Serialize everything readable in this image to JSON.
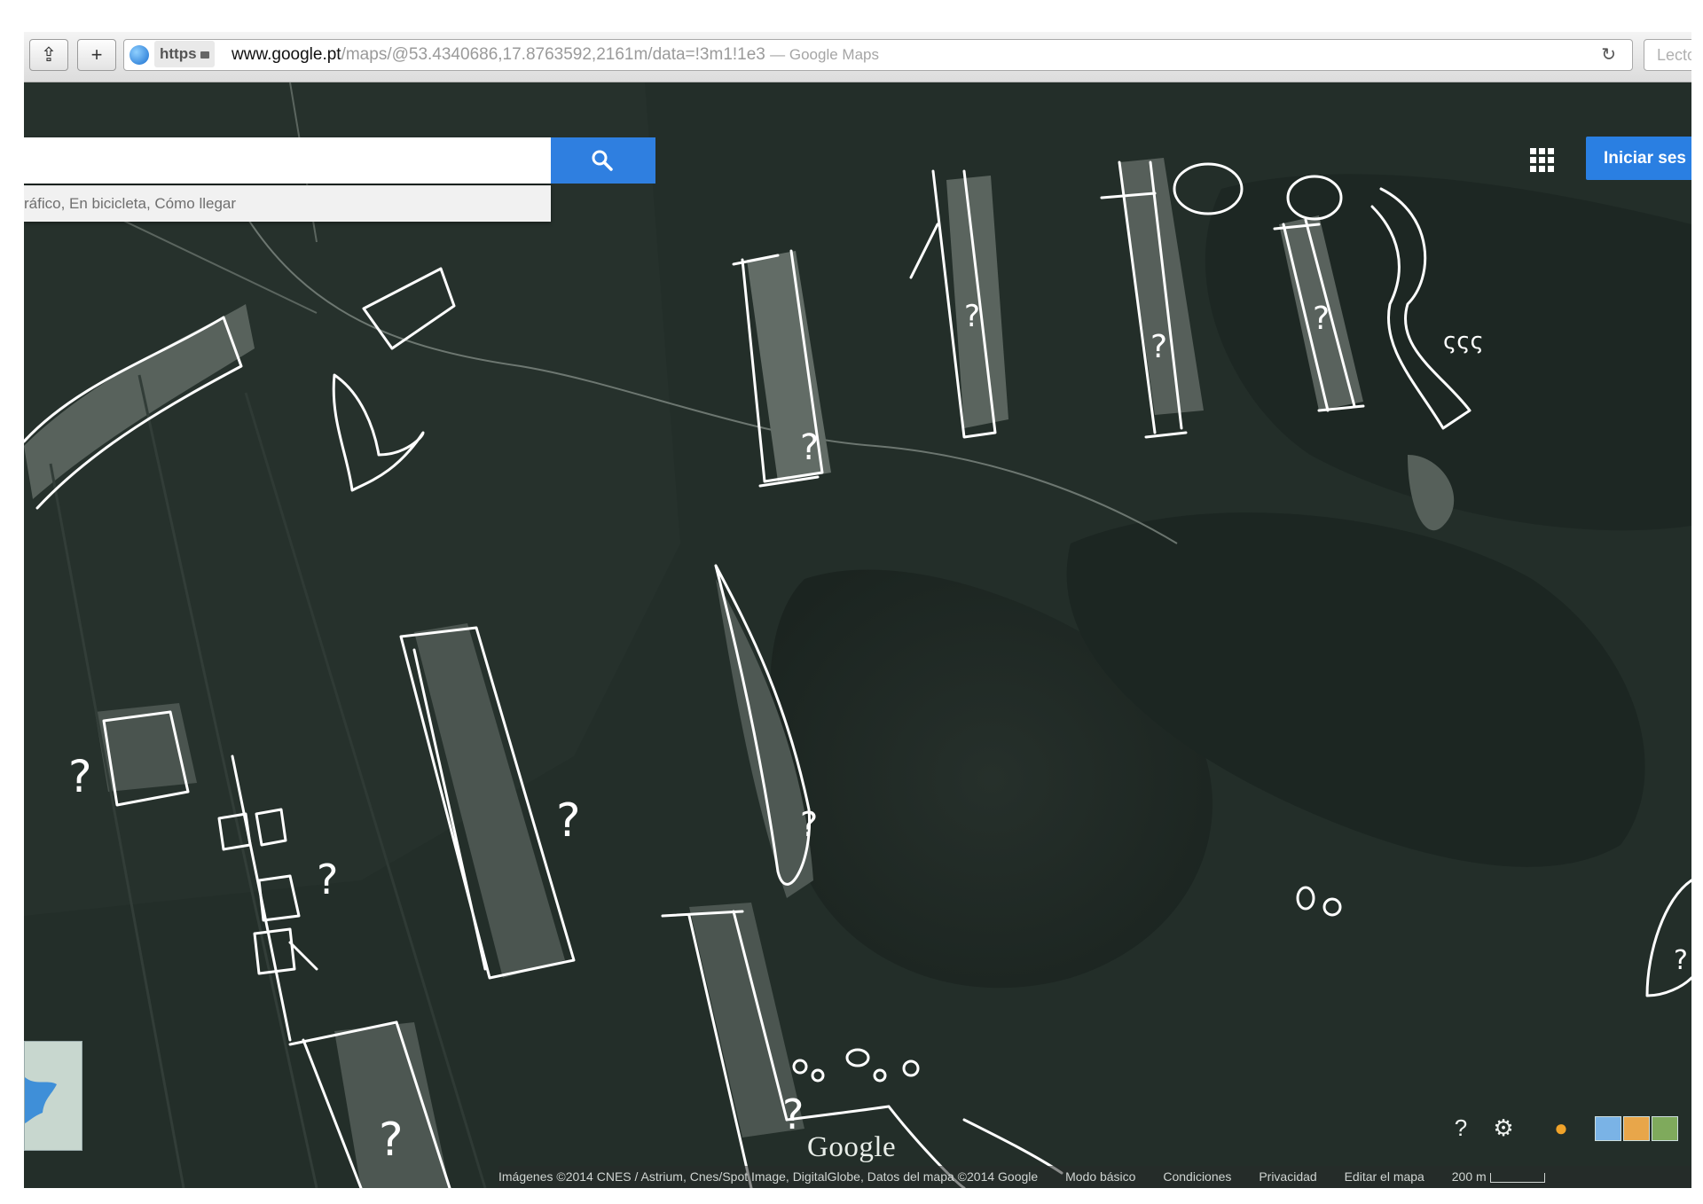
{
  "browser": {
    "share_icon": "share-icon",
    "new_tab_label": "+",
    "https_label": "https",
    "url_domain": "www.google.pt",
    "url_path": "/maps/@53.4340686,17.8763592,2161m/data=!3m1!1e3",
    "page_title": "— Google Maps",
    "reader_label": "Lecto",
    "reload_icon": "reload-icon"
  },
  "maps": {
    "search_value": "",
    "search_icon": "search-icon",
    "suggestions_text": "ráfico, En bicicleta, Cómo llegar",
    "signin_label": "Iniciar ses",
    "apps_icon": "apps-grid-icon",
    "watermark": "Google",
    "help_icon": "help-icon",
    "settings_icon": "gear-icon",
    "pegman_icon": "pegman-icon"
  },
  "footer": {
    "attribution": "Imágenes ©2014 CNES / Astrium, Cnes/Spot Image, DigitalGlobe, Datos del mapa ©2014 Google",
    "basic_mode": "Modo básico",
    "terms": "Condiciones",
    "privacy": "Privacidad",
    "edit_map": "Editar el mapa",
    "scale": "200 m"
  },
  "annotations": {
    "question_mark": "?",
    "marks": [
      "?",
      "?",
      "?",
      "?",
      "?",
      "?",
      "?",
      "?",
      "?",
      "?",
      "?",
      "?",
      "?",
      "?",
      "?"
    ]
  },
  "colors": {
    "accent_blue": "#2f7fe0",
    "forest_dark": "#1f2a25",
    "clearing": "#55605a",
    "ink": "#ffffff"
  }
}
